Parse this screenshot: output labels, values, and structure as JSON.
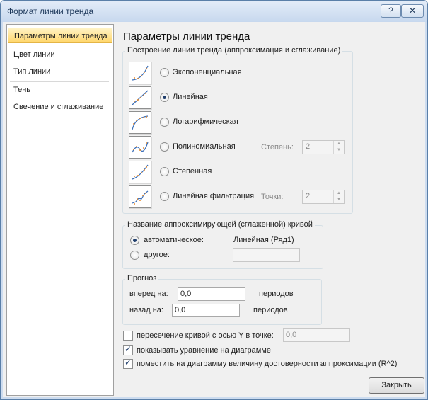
{
  "window": {
    "title": "Формат линии тренда",
    "help_label": "?",
    "close_label": "✕"
  },
  "nav": {
    "items": [
      {
        "label": "Параметры линии тренда"
      },
      {
        "label": "Цвет линии"
      },
      {
        "label": "Тип линии"
      },
      {
        "label": "Тень"
      },
      {
        "label": "Свечение и сглаживание"
      }
    ]
  },
  "main": {
    "heading": "Параметры линии тренда",
    "trend_group_label": "Построение линии тренда (аппроксимация и сглаживание)",
    "trend_types": [
      {
        "label": "Экспоненциальная",
        "selected": false
      },
      {
        "label": "Линейная",
        "selected": true
      },
      {
        "label": "Логарифмическая",
        "selected": false
      },
      {
        "label": "Полиномиальная",
        "selected": false
      },
      {
        "label": "Степенная",
        "selected": false
      },
      {
        "label": "Линейная фильтрация",
        "selected": false
      }
    ],
    "degree_label": "Степень:",
    "degree_value": "2",
    "points_label": "Точки:",
    "points_value": "2",
    "name_group_label": "Название аппроксимирующей (сглаженной) кривой",
    "name_auto_label": "автоматическое:",
    "name_auto_value": "Линейная (Ряд1)",
    "name_other_label": "другое:",
    "name_other_value": "",
    "forecast_group_label": "Прогноз",
    "forward_label": "вперед на:",
    "forward_value": "0,0",
    "forward_unit": "периодов",
    "backward_label": "назад на:",
    "backward_value": "0,0",
    "backward_unit": "периодов",
    "intercept_label": "пересечение кривой с осью Y в точке:",
    "intercept_checked": false,
    "intercept_value": "0,0",
    "show_equation_label": "показывать уравнение на диаграмме",
    "show_equation_checked": true,
    "show_r2_label": "поместить на диаграмму величину достоверности аппроксимации (R^2)",
    "show_r2_checked": true
  },
  "footer": {
    "close_button_label": "Закрыть"
  },
  "colors": {
    "accent": "#ffd66b",
    "title_bar": "#c7d8ee",
    "border": "#5a7fa8"
  }
}
